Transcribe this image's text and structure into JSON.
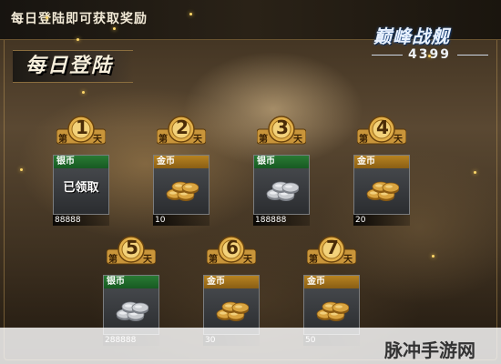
{
  "top_title": "每日登陆即可获取奖励",
  "section_title": "每日登陆",
  "logo": {
    "name": "巅峰战舰",
    "sub": "4399"
  },
  "badge_prefix": "第",
  "badge_suffix": "天",
  "days": [
    {
      "num": "1",
      "currency": "银币",
      "type": "silver",
      "amount": "88888",
      "status": "已领取"
    },
    {
      "num": "2",
      "currency": "金币",
      "type": "gold",
      "amount": "10",
      "status": ""
    },
    {
      "num": "3",
      "currency": "银币",
      "type": "silver",
      "amount": "188888",
      "status": ""
    },
    {
      "num": "4",
      "currency": "金币",
      "type": "gold",
      "amount": "20",
      "status": ""
    },
    {
      "num": "5",
      "currency": "银币",
      "type": "silver",
      "amount": "288888",
      "status": ""
    },
    {
      "num": "6",
      "currency": "金币",
      "type": "gold",
      "amount": "30",
      "status": ""
    },
    {
      "num": "7",
      "currency": "金币",
      "type": "gold",
      "amount": "50",
      "status": ""
    }
  ],
  "watermark": "脉冲手游网",
  "colors": {
    "silver_label": "#1f6f2b",
    "gold_label": "#a87419",
    "badge_gold": "#e2b04a"
  },
  "icons": {
    "silver": "silver-coins-icon",
    "gold": "gold-coins-icon"
  }
}
